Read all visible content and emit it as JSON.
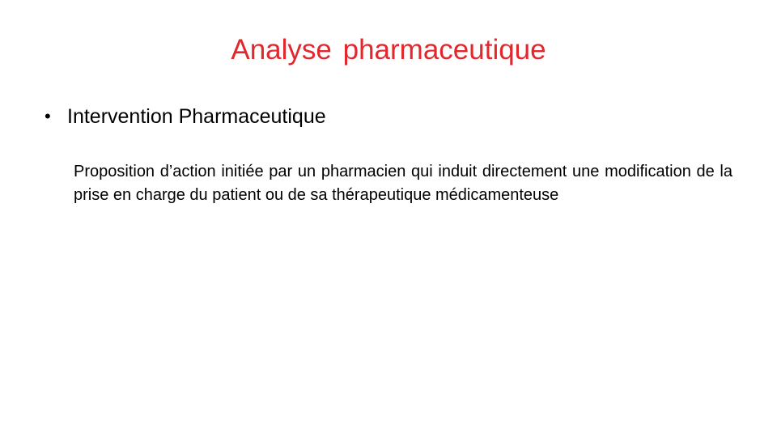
{
  "slide": {
    "title": "Analyse pharmaceutique",
    "bullet": {
      "marker": "•",
      "text": "Intervention Pharmaceutique"
    },
    "definition": "Proposition d’action initiée par un pharmacien qui induit directement une modification de la prise en charge du patient ou de sa thérapeutique médicamenteuse"
  },
  "colors": {
    "title": "#e0282e",
    "text": "#000000",
    "background": "#ffffff"
  }
}
